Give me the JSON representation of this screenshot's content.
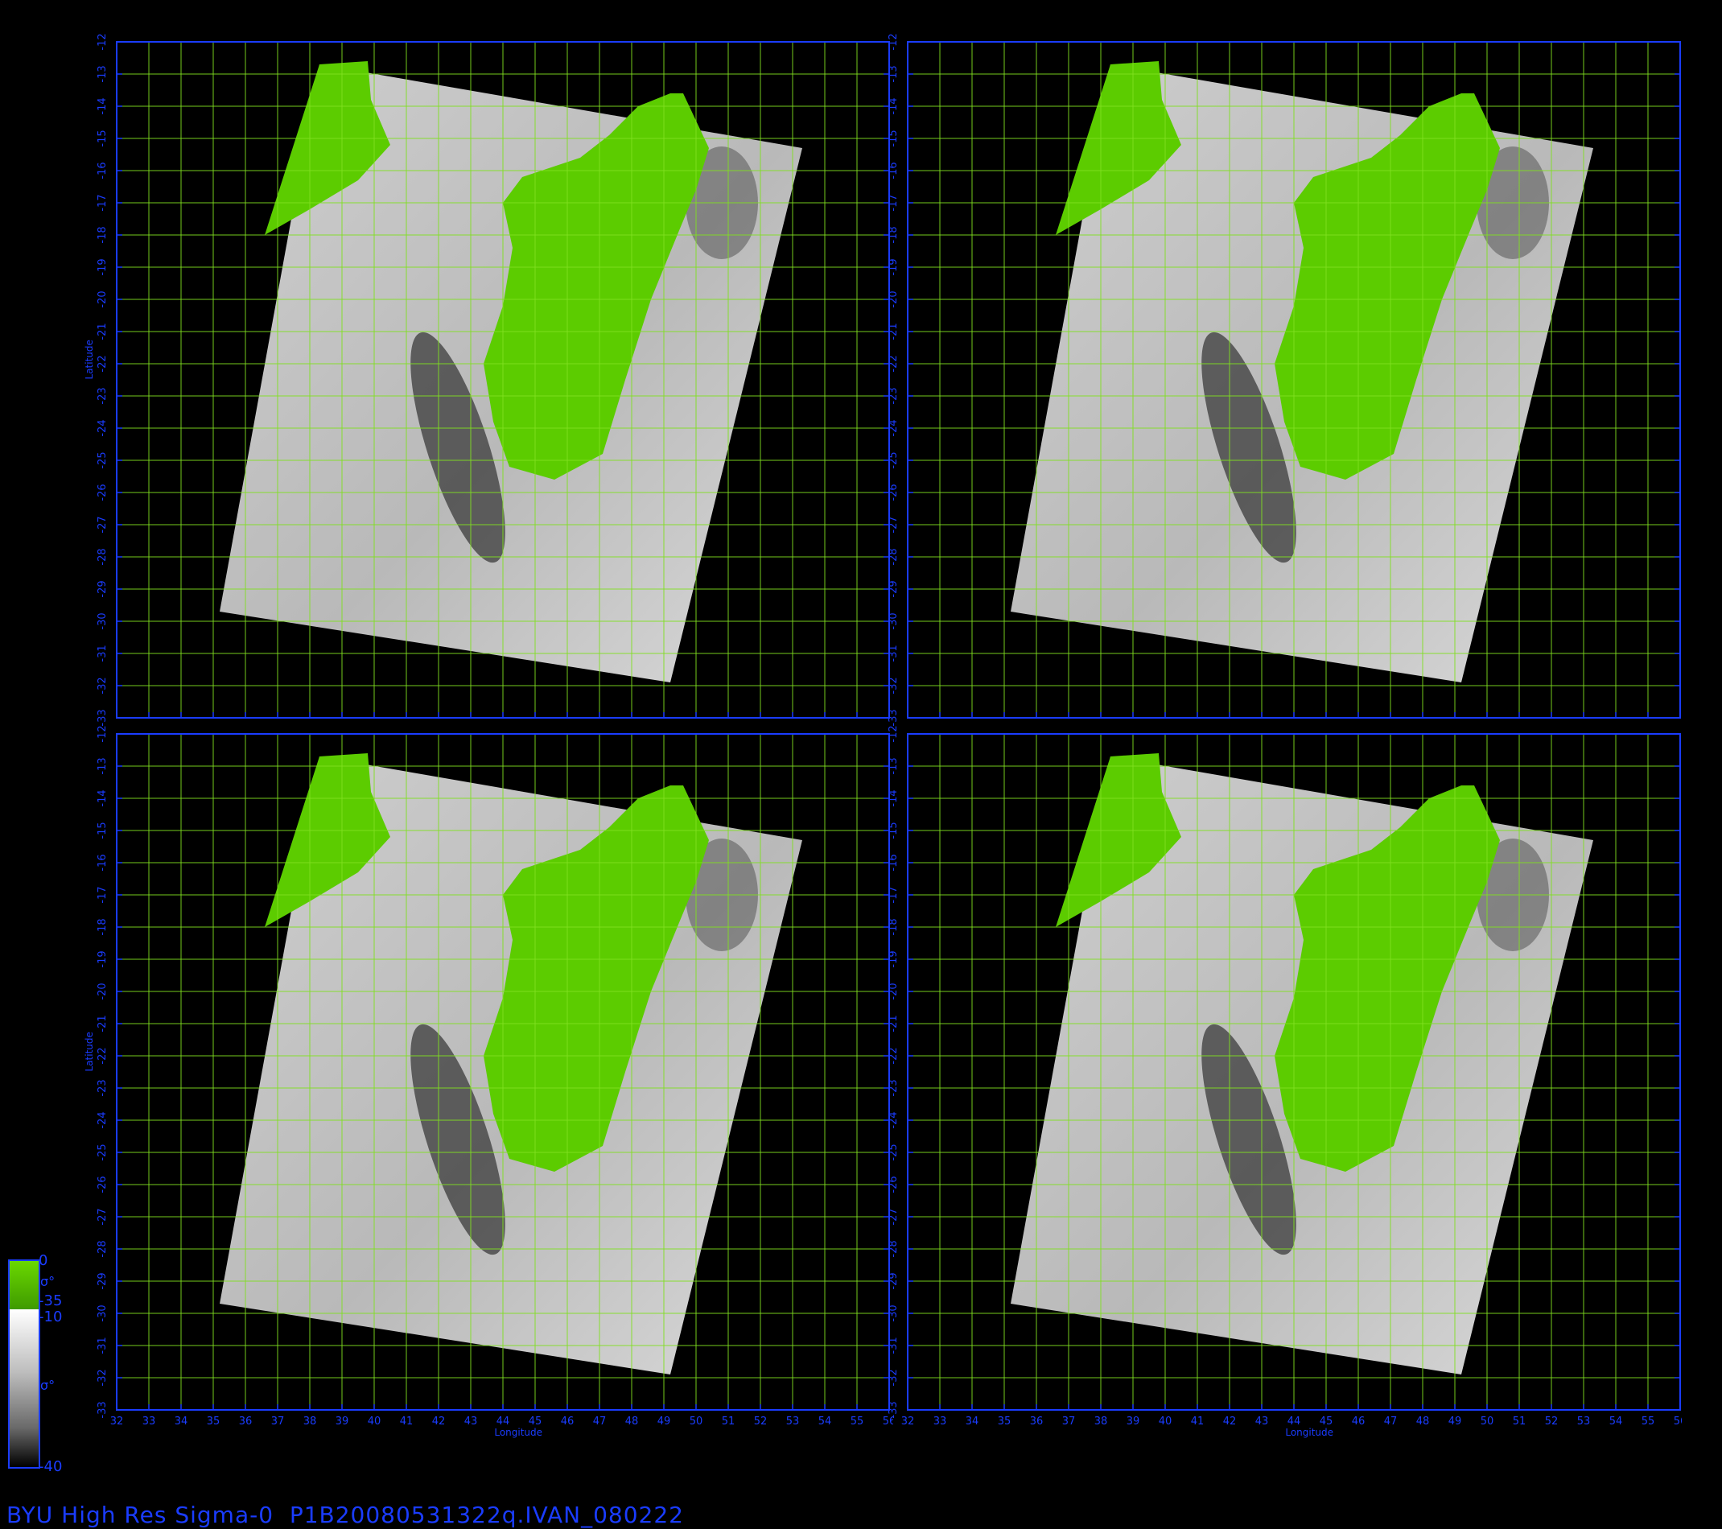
{
  "footer_title": "BYU High Res Sigma-0  P1B20080531322q.IVAN_080222",
  "axes": {
    "xlabel": "Longitude",
    "ylabel": "Latitude",
    "lon_ticks": [
      "32",
      "33",
      "34",
      "35",
      "36",
      "37",
      "38",
      "39",
      "40",
      "41",
      "42",
      "43",
      "44",
      "45",
      "46",
      "47",
      "48",
      "49",
      "50",
      "51",
      "52",
      "53",
      "54",
      "55",
      "56"
    ],
    "lat_ticks": [
      "-12",
      "-13",
      "-14",
      "-15",
      "-16",
      "-17",
      "-18",
      "-19",
      "-20",
      "-21",
      "-22",
      "-23",
      "-24",
      "-25",
      "-26",
      "-27",
      "-28",
      "-29",
      "-30",
      "-31",
      "-32",
      "-33"
    ],
    "lon_range": [
      32,
      56
    ],
    "lat_range": [
      -12,
      -33
    ]
  },
  "colorbar": {
    "land": {
      "max_label": "0",
      "min_label": "-35",
      "unit": "σ°",
      "color": "#5ccc00"
    },
    "ocean": {
      "max_label": "-10",
      "min_label": "-40",
      "unit": "σ°"
    }
  },
  "panels": [
    "top-left",
    "top-right",
    "bottom-left",
    "bottom-right"
  ],
  "colors": {
    "axis": "#1a3cff",
    "grid": "#80e020",
    "land": "#5ccc00",
    "background": "#000000"
  }
}
